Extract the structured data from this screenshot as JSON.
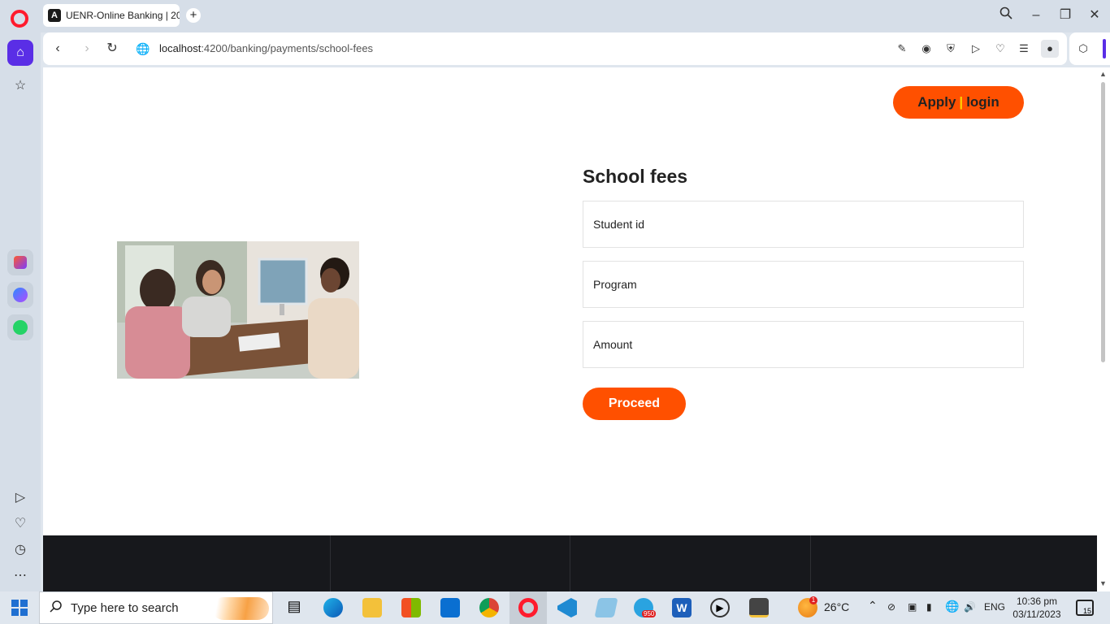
{
  "browser": {
    "tab_title": "UENR-Online Banking | 20",
    "tab_favicon_letter": "A",
    "url_host": "localhost",
    "url_rest": ":4200/banking/payments/school-fees"
  },
  "page": {
    "header_apply": "Apply",
    "header_sep": "|",
    "header_login": "login",
    "form_title": "School fees",
    "fields": {
      "student_id_placeholder": "Student id",
      "program_placeholder": "Program",
      "amount_placeholder": "Amount"
    },
    "proceed_label": "Proceed"
  },
  "taskbar": {
    "search_placeholder": "Type here to search",
    "weather": "26°C",
    "language": "ENG",
    "time": "10:36 pm",
    "date": "03/11/2023",
    "notification_count": "15",
    "telegram_badge": "950",
    "weather_badge": "1"
  },
  "colors": {
    "accent": "#ff5000",
    "opera_red": "#ff1b2d",
    "sidebar_home": "#5a2ee6",
    "footer": "#17181c"
  }
}
